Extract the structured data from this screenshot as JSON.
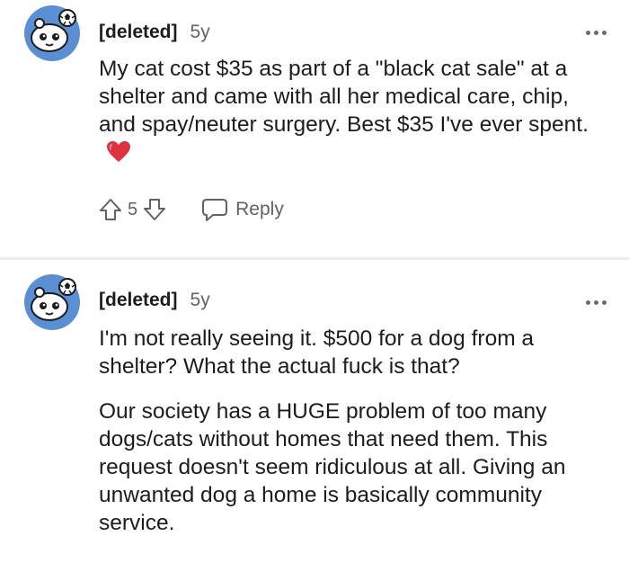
{
  "comments": [
    {
      "username": "[deleted]",
      "age": "5y",
      "paragraphs": [
        "My cat cost $35 as part of a \"black cat sale\" at a shelter and came with all her medical care, chip, and spay/neuter surgery. Best $35 I've ever spent."
      ],
      "score": "5",
      "reply_label": "Reply",
      "more_icon": "more-options-icon"
    },
    {
      "username": "[deleted]",
      "age": "5y",
      "paragraphs": [
        "I'm not really seeing it. $500 for a dog from a shelter? What the actual fuck is that?",
        "Our society has a HUGE problem of too many dogs/cats without homes that need them. This request doesn't seem ridiculous at all. Giving an unwanted dog a home is basically community service."
      ],
      "more_icon": "more-options-icon"
    }
  ],
  "colors": {
    "text": "#1c1c1c",
    "secondary_text": "#5f6368",
    "avatar_bg": "#5b8fd3",
    "heart": "#e0313f",
    "divider": "#ececec"
  }
}
